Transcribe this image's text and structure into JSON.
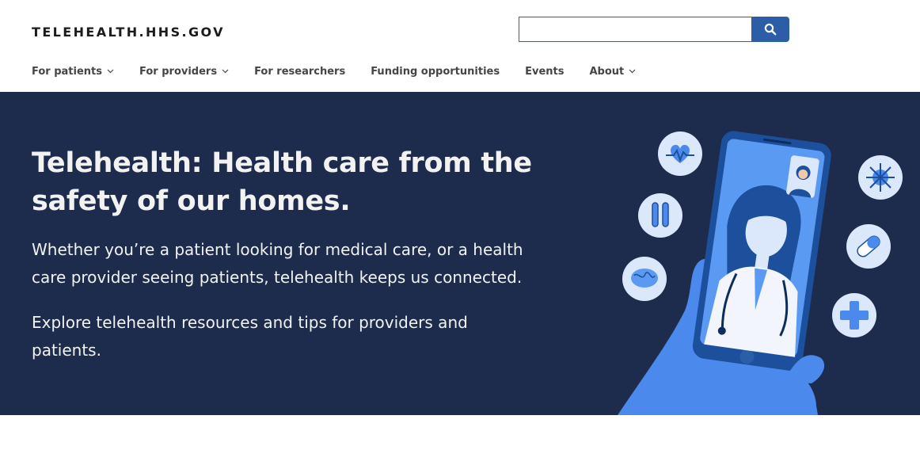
{
  "site": {
    "logo": "TELEHEALTH.HHS.GOV"
  },
  "search": {
    "value": "",
    "button_icon": "search-icon"
  },
  "nav": {
    "items": [
      {
        "label": "For patients",
        "has_dropdown": true
      },
      {
        "label": "For providers",
        "has_dropdown": true
      },
      {
        "label": "For researchers",
        "has_dropdown": false
      },
      {
        "label": "Funding opportunities",
        "has_dropdown": false
      },
      {
        "label": "Events",
        "has_dropdown": false
      },
      {
        "label": "About",
        "has_dropdown": true
      }
    ]
  },
  "hero": {
    "title": "Telehealth: Health care from the safety of our homes.",
    "paragraph1": "Whether you’re a patient looking for medical care, or a health care provider seeing patients, telehealth keeps us connected.",
    "paragraph2": "Explore telehealth resources and tips for providers and patients.",
    "illustration": "hand-holding-phone-with-doctor-illustration"
  },
  "colors": {
    "hero_bg": "#1d2c4c",
    "accent_blue": "#2c5ea8",
    "nav_text": "#454545",
    "illus_light": "#dbe7fa",
    "illus_mid": "#5393f2",
    "illus_dark": "#1c4f9c"
  }
}
